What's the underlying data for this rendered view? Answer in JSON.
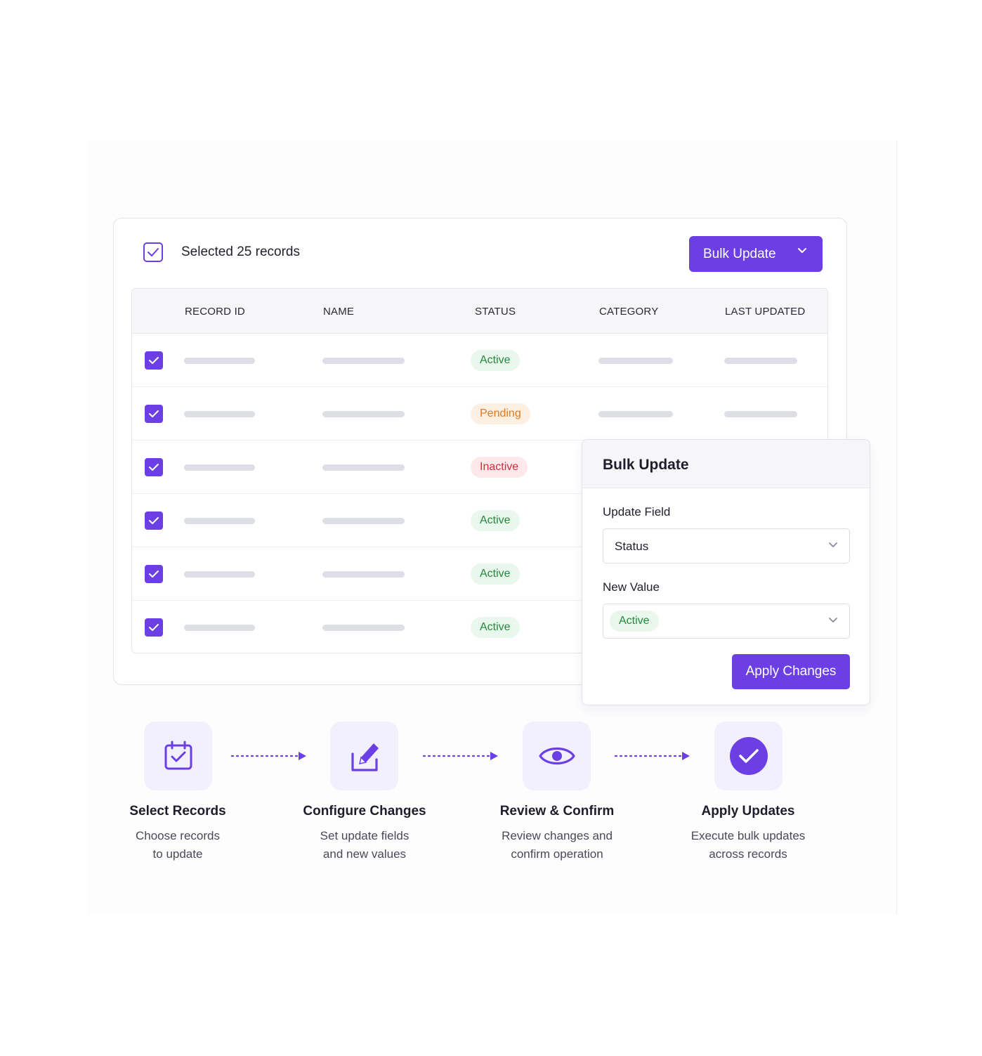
{
  "header": {
    "selected_label": "Selected 25 records",
    "bulk_button_label": "Bulk Update"
  },
  "table": {
    "columns": [
      "RECORD ID",
      "NAME",
      "STATUS",
      "CATEGORY",
      "LAST UPDATED"
    ],
    "rows": [
      {
        "checked": true,
        "status": "Active",
        "status_type": "active"
      },
      {
        "checked": true,
        "status": "Pending",
        "status_type": "pending"
      },
      {
        "checked": true,
        "status": "Inactive",
        "status_type": "inactive"
      },
      {
        "checked": true,
        "status": "Active",
        "status_type": "active"
      },
      {
        "checked": true,
        "status": "Active",
        "status_type": "active"
      },
      {
        "checked": true,
        "status": "Active",
        "status_type": "active"
      }
    ]
  },
  "popover": {
    "title": "Bulk Update",
    "update_field_label": "Update Field",
    "update_field_value": "Status",
    "new_value_label": "New Value",
    "new_value": "Active",
    "apply_label": "Apply Changes"
  },
  "steps": [
    {
      "icon": "calendar-check-icon",
      "title": "Select Records",
      "desc_1": "Choose records",
      "desc_2": "to update"
    },
    {
      "icon": "edit-pencil-icon",
      "title": "Configure Changes",
      "desc_1": "Set update fields",
      "desc_2": "and new values"
    },
    {
      "icon": "eye-icon",
      "title": "Review & Confirm",
      "desc_1": "Review changes and",
      "desc_2": "confirm operation"
    },
    {
      "icon": "check-circle-icon",
      "title": "Apply Updates",
      "desc_1": "Execute bulk updates",
      "desc_2": "across records"
    }
  ],
  "colors": {
    "accent": "#6b3fe4",
    "active": "#1f8a3b",
    "pending": "#e07a1c",
    "inactive": "#d22a3c"
  }
}
